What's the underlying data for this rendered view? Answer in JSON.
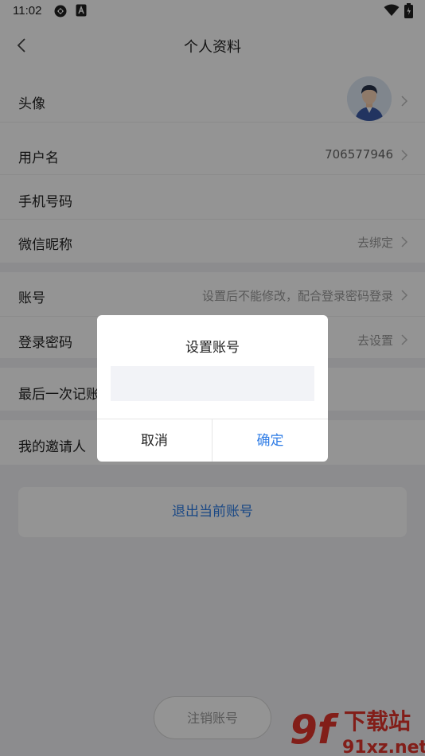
{
  "status_bar": {
    "time": "11:02"
  },
  "header": {
    "title": "个人资料"
  },
  "profile_rows": [
    {
      "label": "头像",
      "value": ""
    },
    {
      "label": "用户名",
      "value": "706577946"
    },
    {
      "label": "手机号码",
      "value": ""
    },
    {
      "label": "微信昵称",
      "value": "去绑定"
    },
    {
      "label": "账号",
      "value": "设置后不能修改，配合登录密码登录"
    },
    {
      "label": "登录密码",
      "value": "去设置"
    },
    {
      "label": "最后一次记账",
      "value": ""
    },
    {
      "label": "我的邀请人",
      "value": ""
    }
  ],
  "logout_label": "退出当前账号",
  "cancel_account_label": "注销账号",
  "dialog": {
    "title": "设置账号",
    "input_value": "",
    "input_placeholder": "",
    "cancel_label": "取消",
    "confirm_label": "确定"
  },
  "watermark": {
    "brand": "下载站",
    "site": "91xz.net",
    "logo": "9f"
  },
  "colors": {
    "accent": "#2e7ce6",
    "overlay": "rgba(0,0,0,0.42)",
    "section_gap": "#f2f2f4"
  }
}
